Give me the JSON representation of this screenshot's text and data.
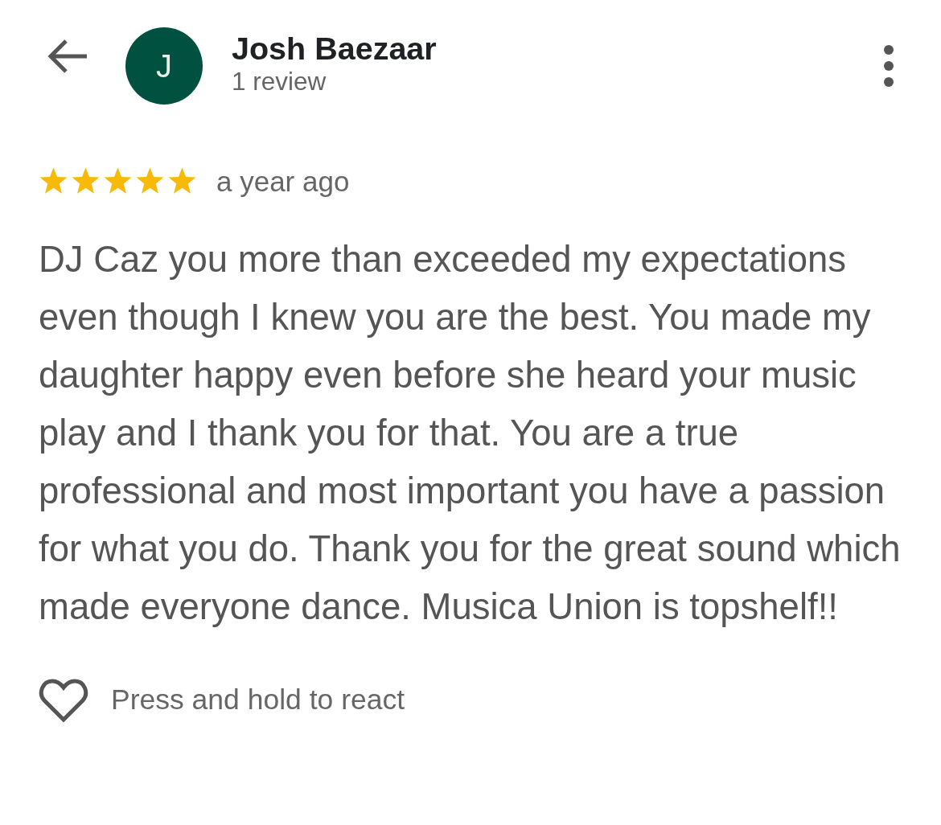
{
  "reviewer": {
    "avatar_letter": "J",
    "name": "Josh Baezaar",
    "review_count": "1 review"
  },
  "review": {
    "stars": 5,
    "time": "a year ago",
    "text": "DJ Caz you more than exceeded my expectations even though I knew you are the best. You made my daughter happy even before she heard your music play and I thank you for that. You are a true professional and most important you have a passion for what you do. Thank you for the great sound which made everyone dance. Musica Union is topshelf!!"
  },
  "reaction": {
    "label": "Press and hold to react"
  }
}
